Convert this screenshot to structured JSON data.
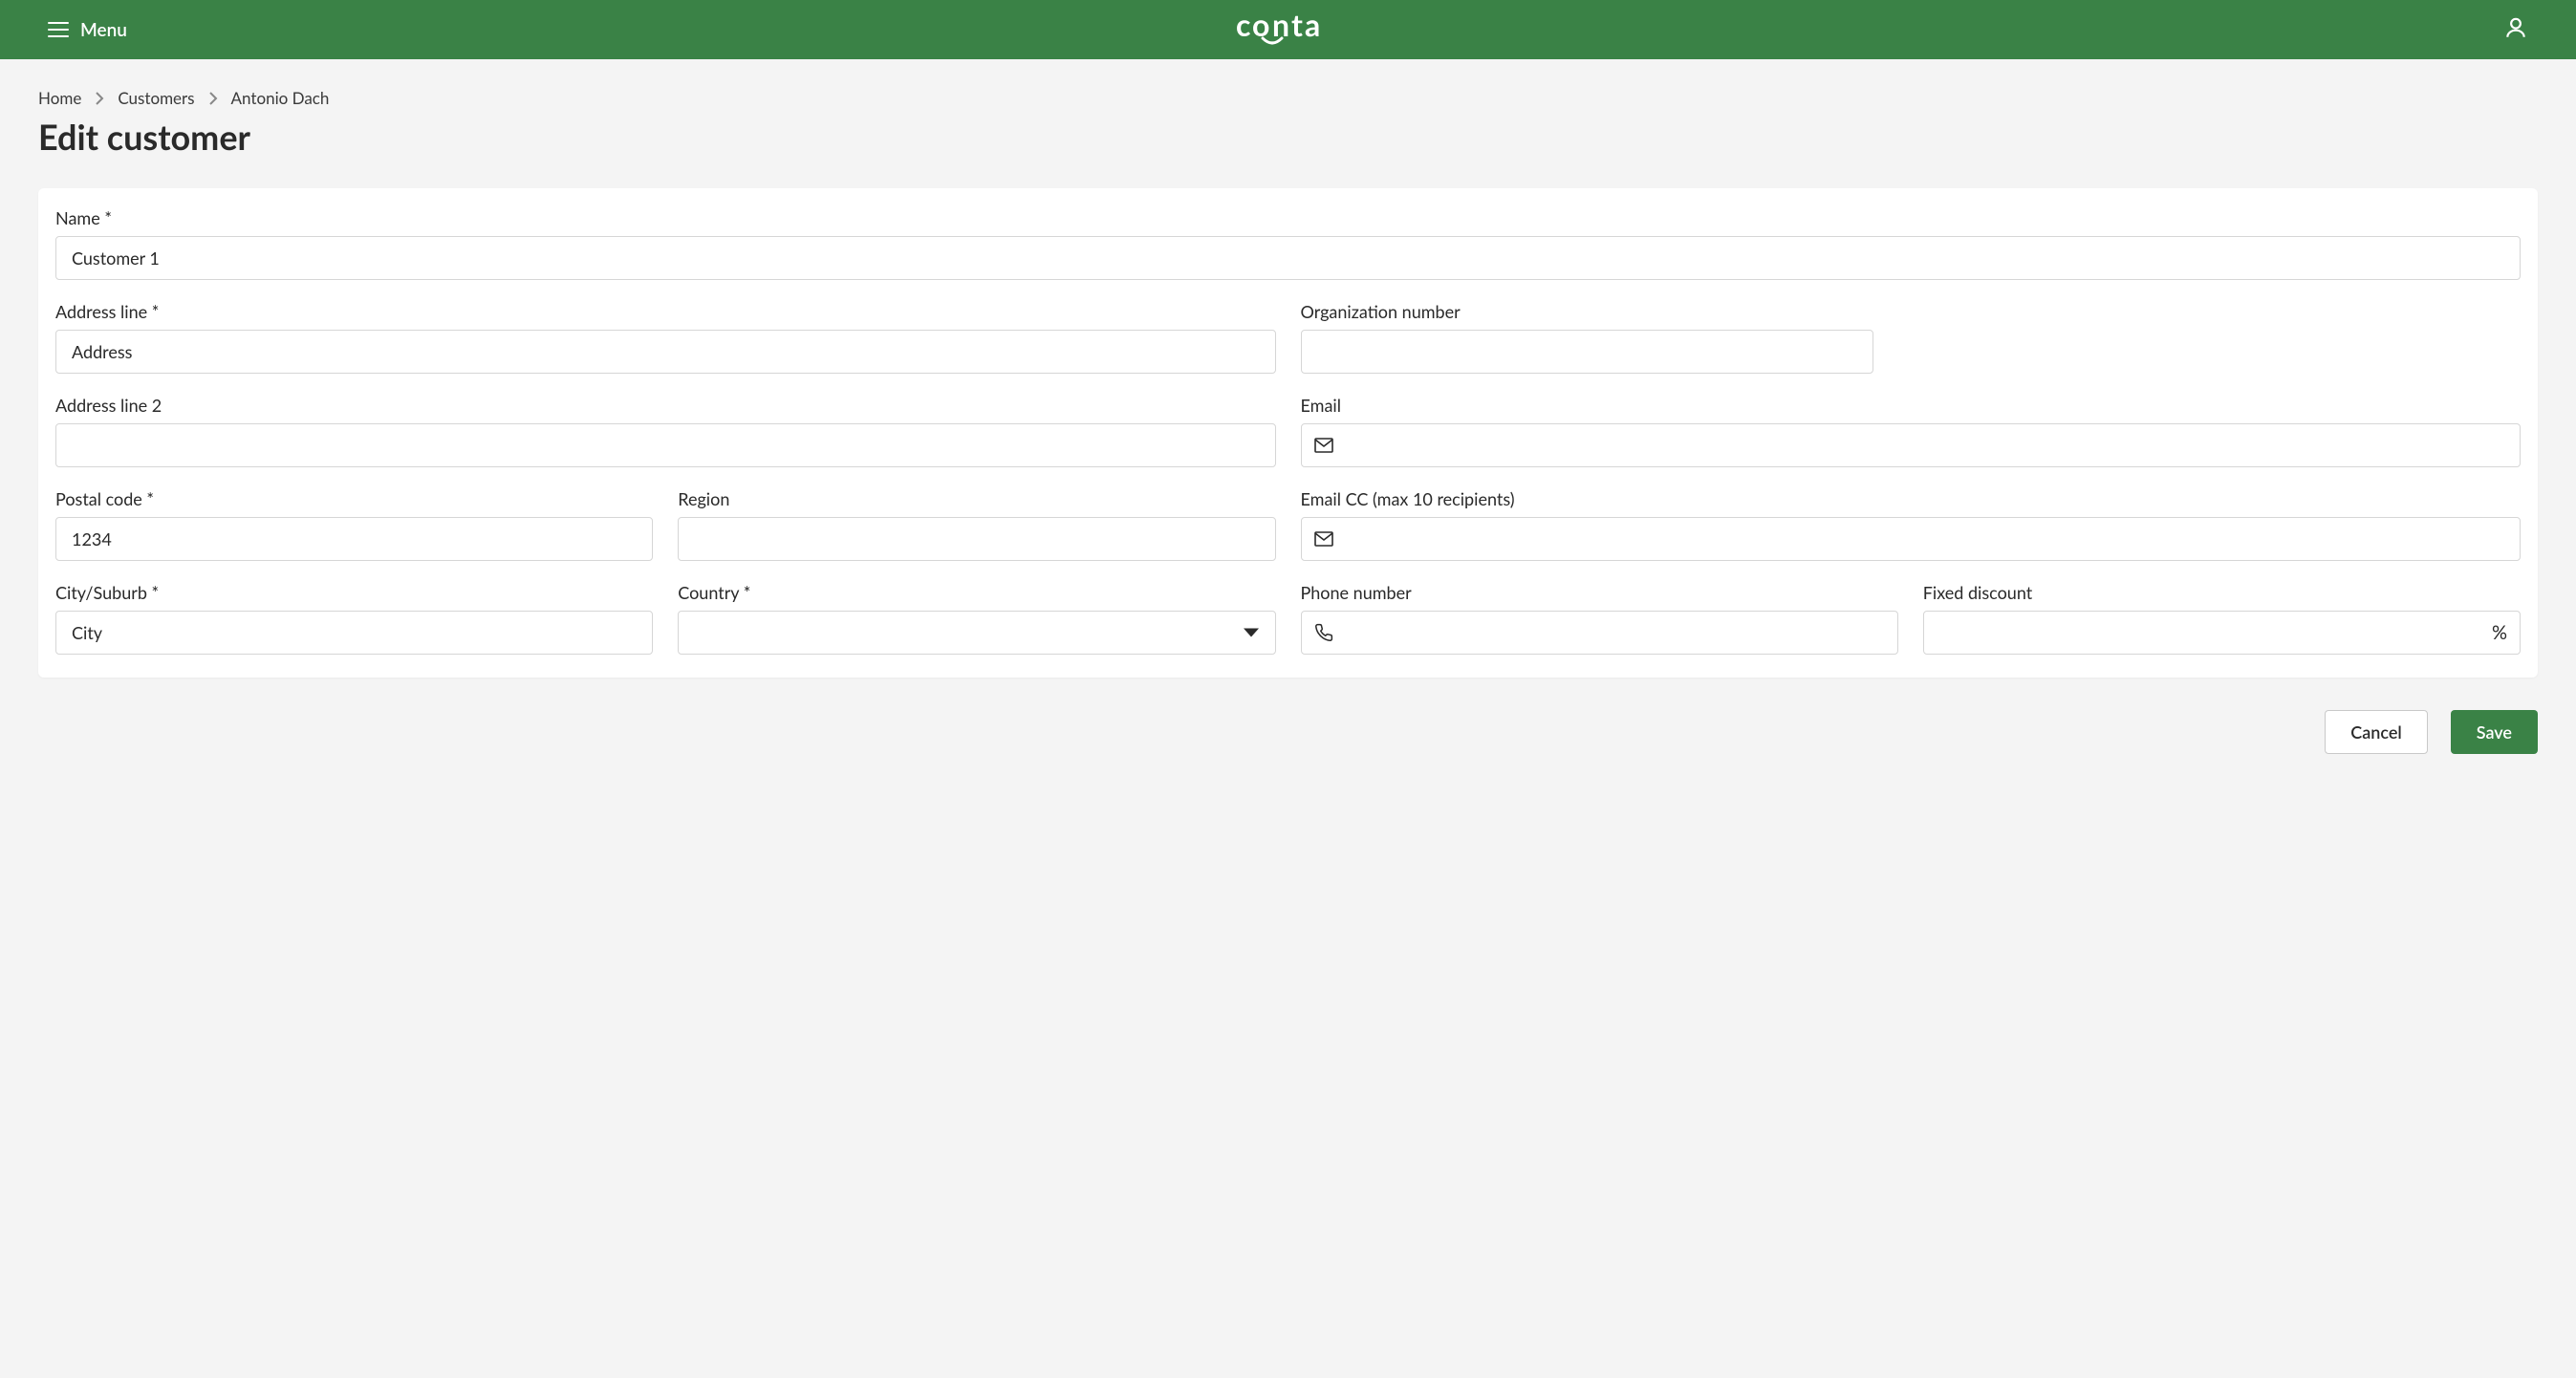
{
  "header": {
    "menu_label": "Menu",
    "brand": "conta"
  },
  "breadcrumb": {
    "home": "Home",
    "customers": "Customers",
    "current": "Antonio Dach"
  },
  "page_title": "Edit customer",
  "form": {
    "name": {
      "label": "Name *",
      "value": "Customer 1"
    },
    "address_line": {
      "label": "Address line *",
      "value": "Address"
    },
    "address_line_2": {
      "label": "Address line 2",
      "value": ""
    },
    "org_number": {
      "label": "Organization number",
      "value": ""
    },
    "email": {
      "label": "Email",
      "value": ""
    },
    "postal_code": {
      "label": "Postal code *",
      "value": "1234"
    },
    "region": {
      "label": "Region",
      "value": ""
    },
    "email_cc": {
      "label": "Email CC (max 10 recipients)",
      "value": ""
    },
    "city": {
      "label": "City/Suburb *",
      "value": "City"
    },
    "country": {
      "label": "Country *",
      "value": ""
    },
    "phone": {
      "label": "Phone number",
      "value": ""
    },
    "fixed_discount": {
      "label": "Fixed discount",
      "value": "",
      "suffix": "%"
    }
  },
  "actions": {
    "cancel": "Cancel",
    "save": "Save"
  }
}
